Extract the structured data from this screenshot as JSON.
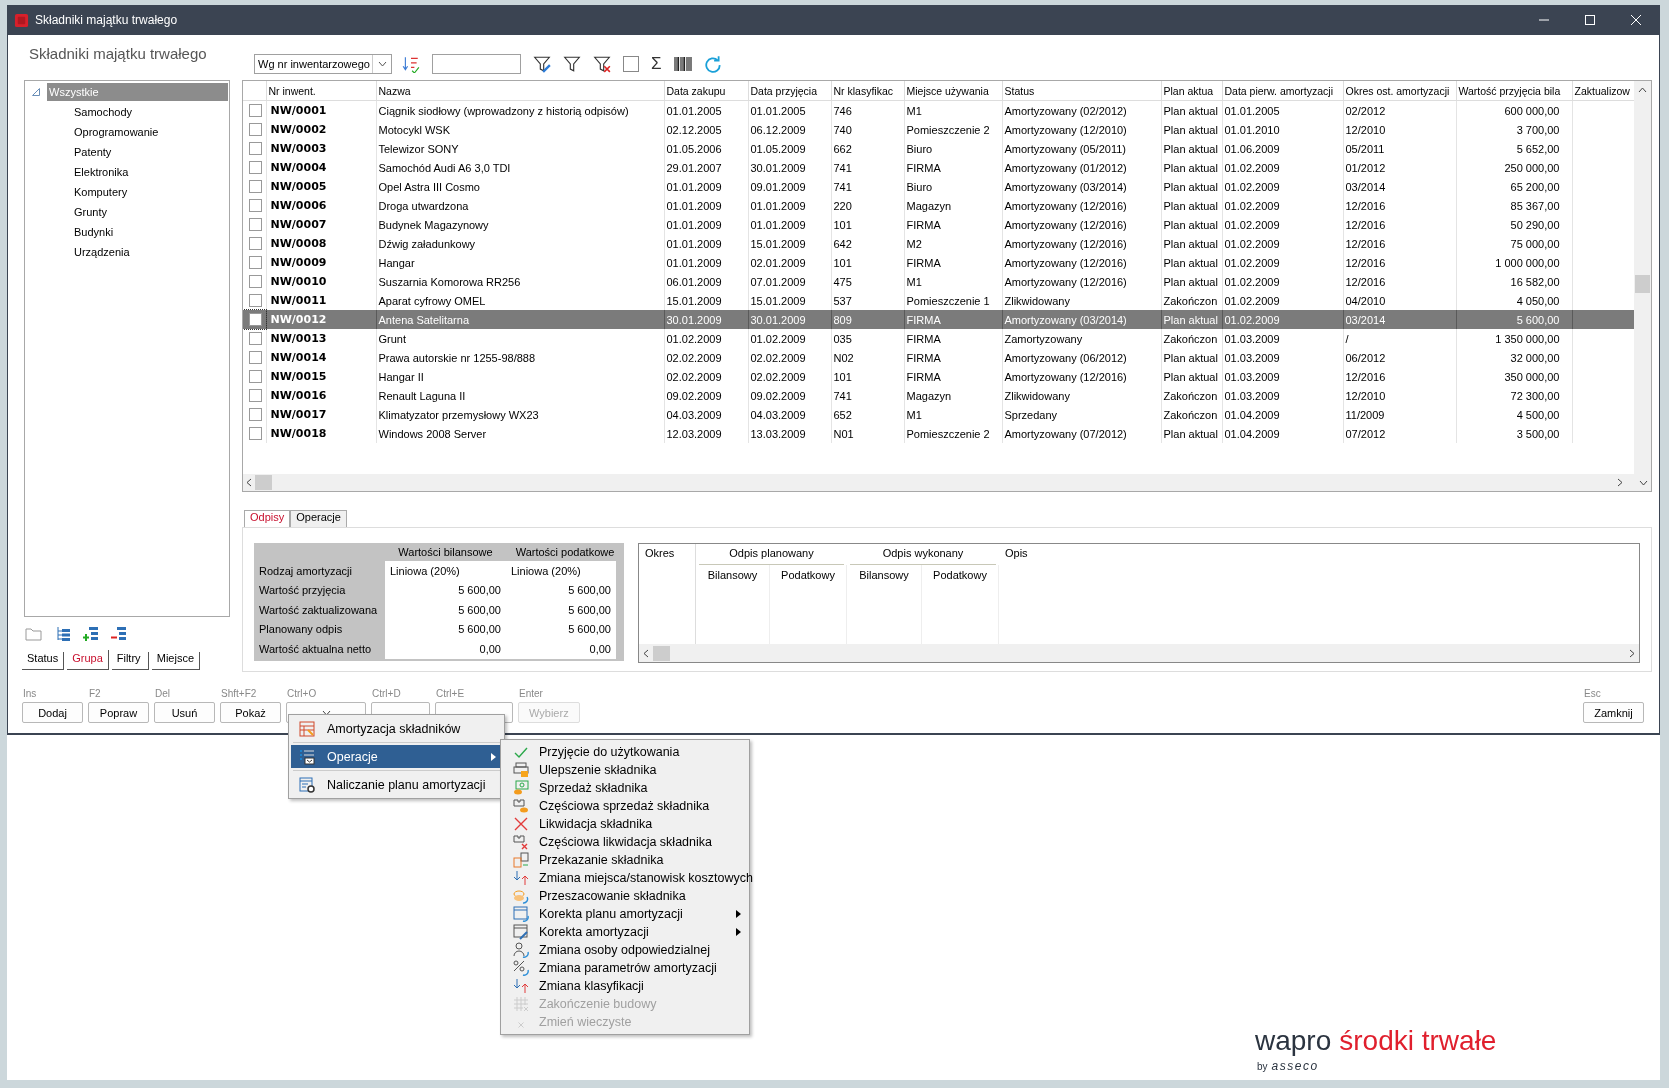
{
  "window": {
    "title": "Składniki majątku trwałego",
    "heading": "Składniki majątku trwałego"
  },
  "toolbar": {
    "sort_by": "Wg nr inwentarzowego",
    "sum_symbol": "Σ"
  },
  "tree": [
    {
      "label": "Wszystkie",
      "selected": true,
      "expanded": true,
      "children": [
        {
          "label": "Samochody",
          "selected": false
        },
        {
          "label": "Oprogramowanie",
          "selected": false
        },
        {
          "label": "Patenty",
          "selected": false
        },
        {
          "label": "Elektronika",
          "selected": false
        },
        {
          "label": "Komputery",
          "selected": false
        },
        {
          "label": "Grunty",
          "selected": false
        },
        {
          "label": "Budynki",
          "selected": false
        },
        {
          "label": "Urządzenia",
          "selected": false
        }
      ]
    }
  ],
  "left_tabs": [
    {
      "label": "Status",
      "selected": false
    },
    {
      "label": "Grupa",
      "selected": true
    },
    {
      "label": "Filtry",
      "selected": false
    },
    {
      "label": "Miejsce",
      "selected": false
    }
  ],
  "table": {
    "columns": [
      "Nr inwent.",
      "Nazwa",
      "Data zakupu",
      "Data przyjęcia",
      "Nr klasyfikac",
      "Miejsce używania",
      "Status",
      "Plan aktua",
      "Data pierw. amortyzacji",
      "Okres ost. amortyzacji",
      "Wartość przyjęcia bila",
      "Zaktualizow"
    ],
    "rows": [
      {
        "checked": false,
        "selected": false,
        "cells": [
          "NW/0001",
          "Ciągnik siodłowy (wprowadzony z historią odpisów)",
          "01.01.2005",
          "01.01.2005",
          "746",
          "M1",
          "Amortyzowany (02/2012)",
          "Plan aktual",
          "01.01.2005",
          "02/2012",
          "600 000,00"
        ]
      },
      {
        "checked": false,
        "selected": false,
        "cells": [
          "NW/0002",
          "Motocykl WSK",
          "02.12.2005",
          "06.12.2009",
          "740",
          "Pomieszczenie 2",
          "Amortyzowany (12/2010)",
          "Plan aktual",
          "01.01.2010",
          "12/2010",
          "3 700,00"
        ]
      },
      {
        "checked": false,
        "selected": false,
        "cells": [
          "NW/0003",
          "Telewizor SONY",
          "01.05.2006",
          "01.05.2009",
          "662",
          "Biuro",
          "Amortyzowany (05/2011)",
          "Plan aktual",
          "01.06.2009",
          "05/2011",
          "5 652,00"
        ]
      },
      {
        "checked": false,
        "selected": false,
        "cells": [
          "NW/0004",
          "Samochód Audi A6 3,0 TDI",
          "29.01.2007",
          "30.01.2009",
          "741",
          "FIRMA",
          "Amortyzowany (01/2012)",
          "Plan aktual",
          "01.02.2009",
          "01/2012",
          "250 000,00"
        ]
      },
      {
        "checked": false,
        "selected": false,
        "cells": [
          "NW/0005",
          "Opel Astra III Cosmo",
          "01.01.2009",
          "09.01.2009",
          "741",
          "Biuro",
          "Amortyzowany (03/2014)",
          "Plan aktual",
          "01.02.2009",
          "03/2014",
          "65 200,00"
        ]
      },
      {
        "checked": false,
        "selected": false,
        "cells": [
          "NW/0006",
          "Droga utwardzona",
          "01.01.2009",
          "01.01.2009",
          "220",
          "Magazyn",
          "Amortyzowany (12/2016)",
          "Plan aktual",
          "01.02.2009",
          "12/2016",
          "85 367,00"
        ]
      },
      {
        "checked": false,
        "selected": false,
        "cells": [
          "NW/0007",
          "Budynek Magazynowy",
          "01.01.2009",
          "01.01.2009",
          "101",
          "FIRMA",
          "Amortyzowany (12/2016)",
          "Plan aktual",
          "01.02.2009",
          "12/2016",
          "50 290,00"
        ]
      },
      {
        "checked": false,
        "selected": false,
        "cells": [
          "NW/0008",
          "Dźwig załadunkowy",
          "01.01.2009",
          "15.01.2009",
          "642",
          "M2",
          "Amortyzowany (12/2016)",
          "Plan aktual",
          "01.02.2009",
          "12/2016",
          "75 000,00"
        ]
      },
      {
        "checked": false,
        "selected": false,
        "cells": [
          "NW/0009",
          "Hangar",
          "01.01.2009",
          "02.01.2009",
          "101",
          "FIRMA",
          "Amortyzowany (12/2016)",
          "Plan aktual",
          "01.02.2009",
          "12/2016",
          "1 000 000,00"
        ]
      },
      {
        "checked": false,
        "selected": false,
        "cells": [
          "NW/0010",
          "Suszarnia Komorowa RR256",
          "06.01.2009",
          "07.01.2009",
          "475",
          "M1",
          "Amortyzowany (12/2016)",
          "Plan aktual",
          "01.02.2009",
          "12/2016",
          "16 582,00"
        ]
      },
      {
        "checked": false,
        "selected": false,
        "cells": [
          "NW/0011",
          "Aparat cyfrowy OMEL",
          "15.01.2009",
          "15.01.2009",
          "537",
          "Pomieszczenie 1",
          "Zlikwidowany",
          "Zakończon",
          "01.02.2009",
          "04/2010",
          "4 050,00"
        ]
      },
      {
        "checked": false,
        "selected": true,
        "cells": [
          "NW/0012",
          "Antena Satelitarna",
          "30.01.2009",
          "30.01.2009",
          "809",
          "FIRMA",
          "Amortyzowany (03/2014)",
          "Plan aktual",
          "01.02.2009",
          "03/2014",
          "5 600,00"
        ]
      },
      {
        "checked": false,
        "selected": false,
        "cells": [
          "NW/0013",
          "Grunt",
          "01.02.2009",
          "01.02.2009",
          "035",
          "FIRMA",
          "Zamortyzowany",
          "Zakończon",
          "01.03.2009",
          "/",
          "1 350 000,00"
        ]
      },
      {
        "checked": false,
        "selected": false,
        "cells": [
          "NW/0014",
          "Prawa autorskie nr 1255-98/888",
          "02.02.2009",
          "02.02.2009",
          "N02",
          "FIRMA",
          "Amortyzowany (06/2012)",
          "Plan aktual",
          "01.03.2009",
          "06/2012",
          "32 000,00"
        ]
      },
      {
        "checked": false,
        "selected": false,
        "cells": [
          "NW/0015",
          "Hangar II",
          "02.02.2009",
          "02.02.2009",
          "101",
          "FIRMA",
          "Amortyzowany (12/2016)",
          "Plan aktual",
          "01.03.2009",
          "12/2016",
          "350 000,00"
        ]
      },
      {
        "checked": false,
        "selected": false,
        "cells": [
          "NW/0016",
          "Renault Laguna II",
          "09.02.2009",
          "09.02.2009",
          "741",
          "Magazyn",
          "Zlikwidowany",
          "Zakończon",
          "01.03.2009",
          "12/2010",
          "72 300,00"
        ]
      },
      {
        "checked": false,
        "selected": false,
        "cells": [
          "NW/0017",
          "Klimatyzator przemysłowy WX23",
          "04.03.2009",
          "04.03.2009",
          "652",
          "M1",
          "Sprzedany",
          "Zakończon",
          "01.04.2009",
          "11/2009",
          "4 500,00"
        ]
      },
      {
        "checked": false,
        "selected": false,
        "cells": [
          "NW/0018",
          "Windows 2008 Server",
          "12.03.2009",
          "13.03.2009",
          "N01",
          "Pomieszczenie 2",
          "Amortyzowany (07/2012)",
          "Plan aktual",
          "01.04.2009",
          "07/2012",
          "3 500,00"
        ]
      }
    ]
  },
  "detail_tabs": [
    {
      "label": "Odpisy",
      "selected": true
    },
    {
      "label": "Operacje",
      "selected": false
    }
  ],
  "summary": {
    "columns": [
      "Wartości bilansowe",
      "Wartości podatkowe"
    ],
    "rows": [
      {
        "label": "Rodzaj amortyzacji",
        "values": [
          "Liniowa (20%)",
          "Liniowa (20%)"
        ]
      },
      {
        "label": "Wartość przyjęcia",
        "values": [
          "5 600,00",
          "5 600,00"
        ]
      },
      {
        "label": "Wartość zaktualizowana",
        "values": [
          "5 600,00",
          "5 600,00"
        ]
      },
      {
        "label": "Planowany odpis",
        "values": [
          "5 600,00",
          "5 600,00"
        ]
      },
      {
        "label": "Wartość aktualna netto",
        "values": [
          "0,00",
          "0,00"
        ]
      }
    ]
  },
  "write_offs": {
    "columns": [
      {
        "label": "Okres"
      },
      {
        "label": "Odpis planowany",
        "sub": [
          "Bilansowy",
          "Podatkowy"
        ]
      },
      {
        "label": "Odpis wykonany",
        "sub": [
          "Bilansowy",
          "Podatkowy"
        ]
      },
      {
        "label": "Opis"
      }
    ]
  },
  "actions": [
    {
      "shortcut": "Ins",
      "label": "Dodaj",
      "kind": "button",
      "disabled": false
    },
    {
      "shortcut": "F2",
      "label": "Popraw",
      "kind": "button",
      "disabled": false
    },
    {
      "shortcut": "Del",
      "label": "Usuń",
      "kind": "button",
      "disabled": false
    },
    {
      "shortcut": "Shft+F2",
      "label": "Pokaż",
      "kind": "button",
      "disabled": false
    },
    {
      "shortcut": "Ctrl+O",
      "kind": "dropdown",
      "disabled": false
    },
    {
      "shortcut": "Ctrl+D",
      "kind": "button",
      "disabled": false
    },
    {
      "shortcut": "Ctrl+E",
      "kind": "button",
      "disabled": false
    },
    {
      "shortcut": "Enter",
      "label": "Wybierz",
      "kind": "button",
      "disabled": true
    }
  ],
  "close_action": {
    "shortcut": "Esc",
    "label": "Zamknij"
  },
  "menu": {
    "items": [
      {
        "label": "Amortyzacja składników",
        "selected": false,
        "has_submenu": false
      },
      {
        "label": "Operacje",
        "selected": true,
        "has_submenu": true
      },
      {
        "label": "Naliczanie planu amortyzacji",
        "selected": false,
        "has_submenu": false
      }
    ]
  },
  "submenu": {
    "items": [
      {
        "label": "Przyjęcie do użytkowania",
        "disabled": false,
        "has_submenu": false
      },
      {
        "label": "Ulepszenie składnika",
        "disabled": false,
        "has_submenu": false
      },
      {
        "label": "Sprzedaż składnika",
        "disabled": false,
        "has_submenu": false
      },
      {
        "label": "Częściowa sprzedaż składnika",
        "disabled": false,
        "has_submenu": false
      },
      {
        "label": "Likwidacja składnika",
        "disabled": false,
        "has_submenu": false
      },
      {
        "label": "Częściowa likwidacja składnika",
        "disabled": false,
        "has_submenu": false
      },
      {
        "label": "Przekazanie składnika",
        "disabled": false,
        "has_submenu": false
      },
      {
        "label": "Zmiana miejsca/stanowisk kosztowych",
        "disabled": false,
        "has_submenu": false
      },
      {
        "label": "Przeszacowanie składnika",
        "disabled": false,
        "has_submenu": false
      },
      {
        "label": "Korekta planu amortyzacji",
        "disabled": false,
        "has_submenu": true
      },
      {
        "label": "Korekta amortyzacji",
        "disabled": false,
        "has_submenu": true
      },
      {
        "label": "Zmiana osoby odpowiedzialnej",
        "disabled": false,
        "has_submenu": false
      },
      {
        "label": "Zmiana parametrów amortyzacji",
        "disabled": false,
        "has_submenu": false
      },
      {
        "label": "Zmiana klasyfikacji",
        "disabled": false,
        "has_submenu": false
      },
      {
        "label": "Zakończenie budowy",
        "disabled": true,
        "has_submenu": false
      },
      {
        "label": "Zmień wieczyste",
        "disabled": true,
        "has_submenu": false
      }
    ]
  },
  "logo": {
    "brand": "wapro",
    "product": "środki trwałe",
    "by": "by",
    "company": "asseco"
  }
}
